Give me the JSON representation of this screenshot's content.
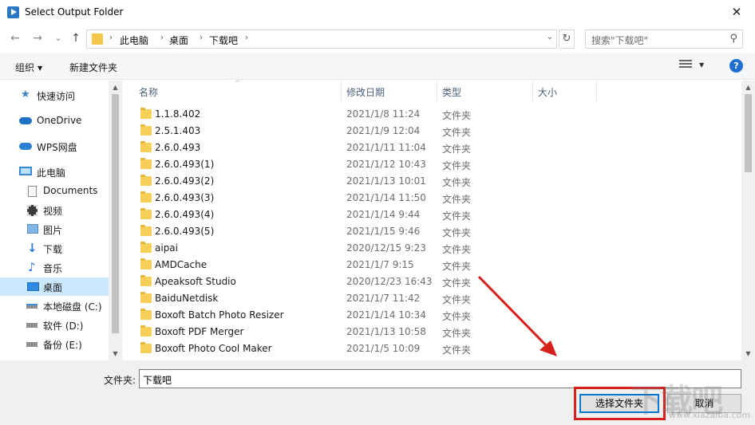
{
  "window": {
    "title": "Select Output Folder",
    "close": "✕"
  },
  "nav": {
    "back": "←",
    "forward": "→",
    "recent": "⌄",
    "up": "↑",
    "breadcrumbs": [
      "此电脑",
      "桌面",
      "下载吧"
    ],
    "refresh": "↻",
    "search_placeholder": "搜索\"下载吧\""
  },
  "toolbar": {
    "organize": "组织",
    "new_folder": "新建文件夹",
    "help": "?"
  },
  "navpane": {
    "items": [
      {
        "label": "快速访问",
        "icon": "star-icon",
        "selected": false
      },
      {
        "label": "OneDrive",
        "icon": "cloud-icon",
        "selected": false
      },
      {
        "label": "WPS网盘",
        "icon": "wps-cloud-icon",
        "selected": false
      },
      {
        "label": "此电脑",
        "icon": "computer-icon",
        "selected": false
      },
      {
        "label": "Documents",
        "icon": "document-icon",
        "selected": false
      },
      {
        "label": "视频",
        "icon": "video-icon",
        "selected": false
      },
      {
        "label": "图片",
        "icon": "picture-icon",
        "selected": false
      },
      {
        "label": "下载",
        "icon": "download-icon",
        "selected": false
      },
      {
        "label": "音乐",
        "icon": "music-icon",
        "selected": false
      },
      {
        "label": "桌面",
        "icon": "desktop-icon",
        "selected": true
      },
      {
        "label": "本地磁盘 (C:)",
        "icon": "drive-icon",
        "selected": false
      },
      {
        "label": "软件 (D:)",
        "icon": "drive-icon",
        "selected": false
      },
      {
        "label": "备份 (E:)",
        "icon": "drive-icon",
        "selected": false
      }
    ]
  },
  "filelist": {
    "columns": [
      "名称",
      "修改日期",
      "类型",
      "大小"
    ],
    "rows": [
      {
        "name": "1.1.8.402",
        "date": "2021/1/8 11:24",
        "type": "文件夹"
      },
      {
        "name": "2.5.1.403",
        "date": "2021/1/9 12:04",
        "type": "文件夹"
      },
      {
        "name": "2.6.0.493",
        "date": "2021/1/11 11:04",
        "type": "文件夹"
      },
      {
        "name": "2.6.0.493(1)",
        "date": "2021/1/12 10:43",
        "type": "文件夹"
      },
      {
        "name": "2.6.0.493(2)",
        "date": "2021/1/13 10:01",
        "type": "文件夹"
      },
      {
        "name": "2.6.0.493(3)",
        "date": "2021/1/14 11:50",
        "type": "文件夹"
      },
      {
        "name": "2.6.0.493(4)",
        "date": "2021/1/14 9:44",
        "type": "文件夹"
      },
      {
        "name": "2.6.0.493(5)",
        "date": "2021/1/15 9:46",
        "type": "文件夹"
      },
      {
        "name": "aipai",
        "date": "2020/12/15 9:23",
        "type": "文件夹"
      },
      {
        "name": "AMDCache",
        "date": "2021/1/7 9:15",
        "type": "文件夹"
      },
      {
        "name": "Apeaksoft Studio",
        "date": "2020/12/23 16:43",
        "type": "文件夹"
      },
      {
        "name": "BaiduNetdisk",
        "date": "2021/1/7 11:42",
        "type": "文件夹"
      },
      {
        "name": "Boxoft Batch Photo Resizer",
        "date": "2021/1/14 10:34",
        "type": "文件夹"
      },
      {
        "name": "Boxoft PDF Merger",
        "date": "2021/1/13 10:58",
        "type": "文件夹"
      },
      {
        "name": "Boxoft Photo Cool Maker",
        "date": "2021/1/5 10:09",
        "type": "文件夹"
      }
    ]
  },
  "bottom": {
    "folder_label": "文件夹:",
    "folder_value": "下载吧",
    "select_button": "选择文件夹",
    "cancel_button": "取消"
  },
  "colors": {
    "selected_bg": "#cce8ff",
    "accent": "#0078d7",
    "highlight": "#d6201c"
  },
  "watermark": {
    "main": "下载吧",
    "sub": "www.xiazaiba.com"
  }
}
